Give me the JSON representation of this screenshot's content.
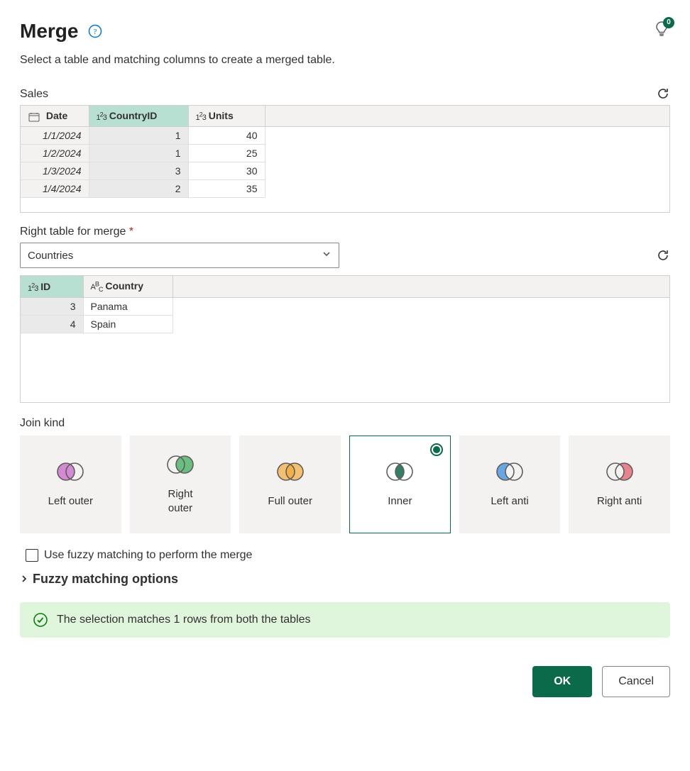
{
  "header": {
    "title": "Merge",
    "idea_badge": "0",
    "subtitle": "Select a table and matching columns to create a merged table."
  },
  "left_table": {
    "name": "Sales",
    "columns": [
      {
        "name": "Date",
        "type": "date",
        "selected": false
      },
      {
        "name": "CountryID",
        "type": "number",
        "selected": true
      },
      {
        "name": "Units",
        "type": "number",
        "selected": false
      }
    ],
    "rows": [
      {
        "Date": "1/1/2024",
        "CountryID": "1",
        "Units": "40"
      },
      {
        "Date": "1/2/2024",
        "CountryID": "1",
        "Units": "25"
      },
      {
        "Date": "1/3/2024",
        "CountryID": "3",
        "Units": "30"
      },
      {
        "Date": "1/4/2024",
        "CountryID": "2",
        "Units": "35"
      }
    ]
  },
  "right_section": {
    "label": "Right table for merge",
    "required_mark": "*",
    "selected_table": "Countries"
  },
  "right_table": {
    "columns": [
      {
        "name": "ID",
        "type": "number",
        "selected": true
      },
      {
        "name": "Country",
        "type": "text",
        "selected": false
      }
    ],
    "rows": [
      {
        "ID": "3",
        "Country": "Panama"
      },
      {
        "ID": "4",
        "Country": "Spain"
      }
    ]
  },
  "join": {
    "label": "Join kind",
    "options": [
      {
        "id": "left-outer",
        "label": "Left outer",
        "fill": "#c65cc6"
      },
      {
        "id": "right-outer",
        "label": "Right outer",
        "fill": "#2fa84f"
      },
      {
        "id": "full-outer",
        "label": "Full outer",
        "fill": "#f2a93b"
      },
      {
        "id": "inner",
        "label": "Inner",
        "fill": "#0b6a4a"
      },
      {
        "id": "left-anti",
        "label": "Left anti",
        "fill": "#3a8dde"
      },
      {
        "id": "right-anti",
        "label": "Right anti",
        "fill": "#e35d6a"
      }
    ],
    "selected": "inner"
  },
  "fuzzy": {
    "checkbox_label": "Use fuzzy matching to perform the merge",
    "expander_label": "Fuzzy matching options"
  },
  "status": {
    "message": "The selection matches 1 rows from both the tables"
  },
  "footer": {
    "ok": "OK",
    "cancel": "Cancel"
  }
}
